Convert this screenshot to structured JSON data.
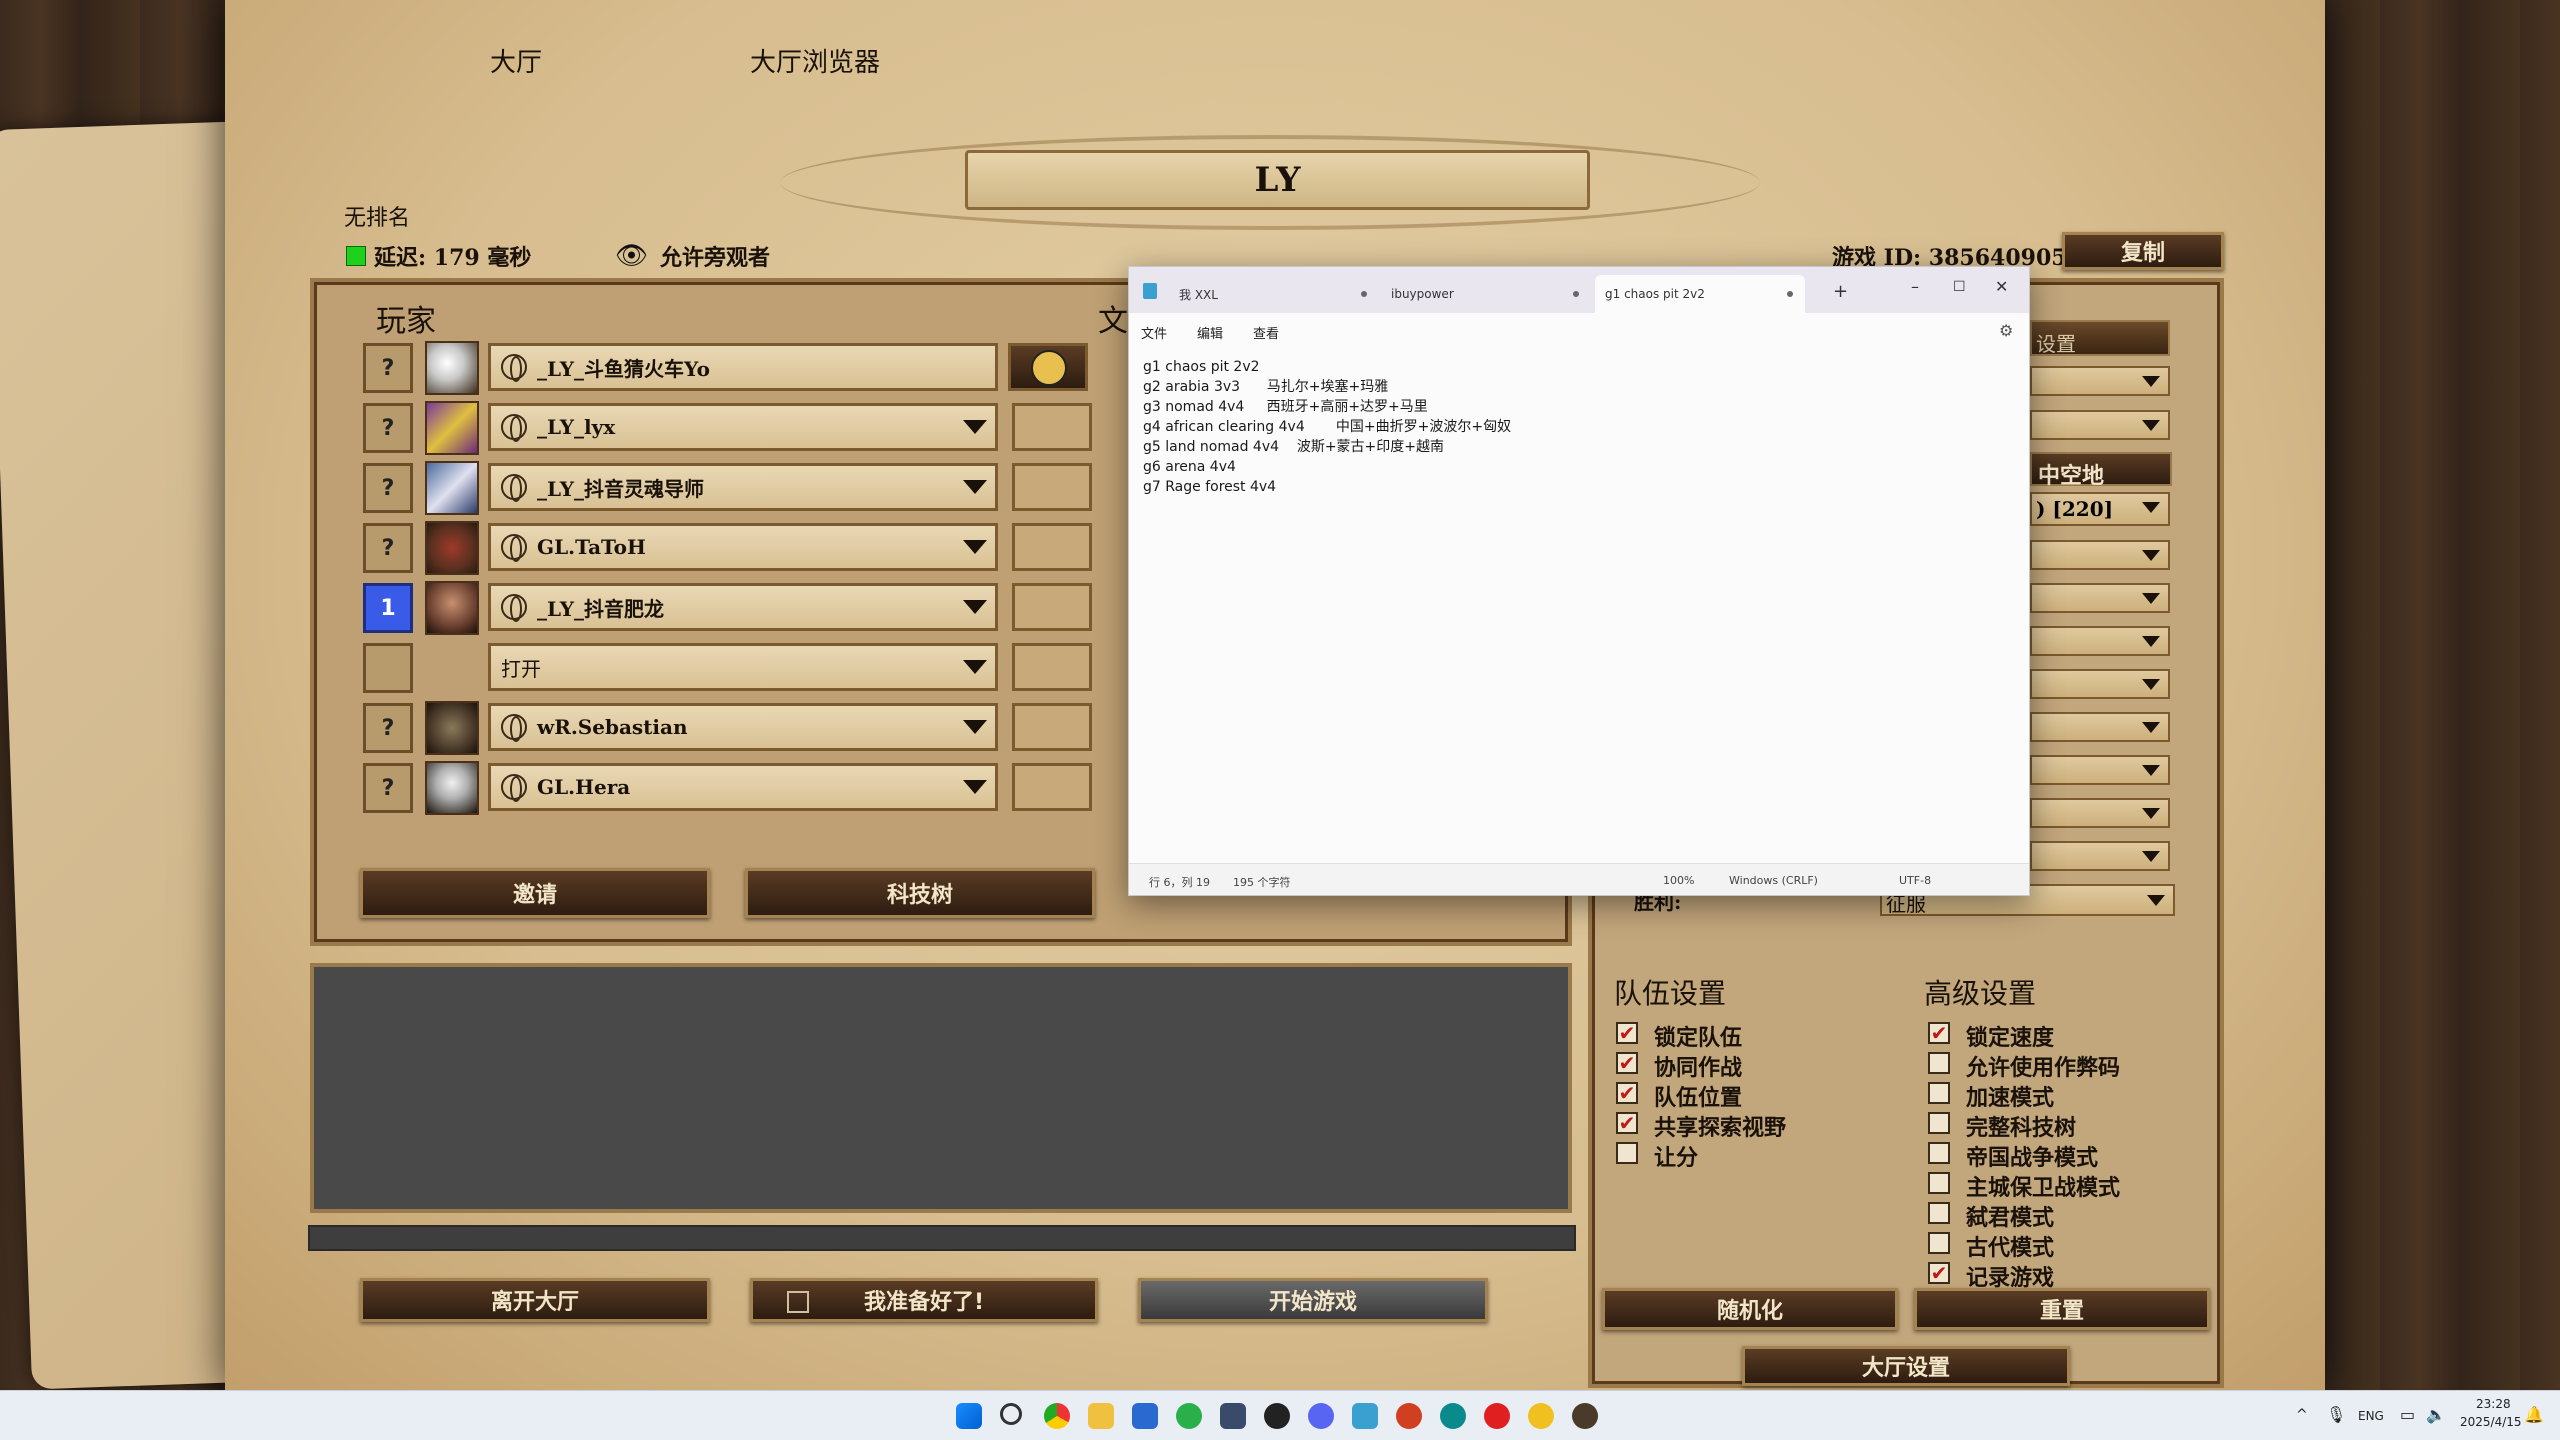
{
  "tabs": {
    "lobby": "大厅",
    "browser": "大厅浏览器"
  },
  "lobby_title": "LY",
  "rank": "无排名",
  "latency": "延迟: 179 毫秒",
  "spectators": "允许旁观者",
  "game_id": "游戏 ID: 385640905",
  "copy_button": "复制",
  "players_header": "玩家",
  "text_header_partial": "文",
  "players": [
    {
      "slot": "?",
      "name": "_LY_斗鱼猜火车Yo",
      "has_dropdown": false
    },
    {
      "slot": "?",
      "name": "_LY_lyx",
      "has_dropdown": true
    },
    {
      "slot": "?",
      "name": "_LY_抖音灵魂导师",
      "has_dropdown": true
    },
    {
      "slot": "?",
      "name": "GL.TaToH",
      "has_dropdown": true
    },
    {
      "slot": "1",
      "name": "_LY_抖音肥龙",
      "has_dropdown": true
    },
    {
      "slot": "",
      "name": "打开",
      "has_dropdown": true
    },
    {
      "slot": "?",
      "name": "wR.Sebastian",
      "has_dropdown": true
    },
    {
      "slot": "?",
      "name": "GL.Hera",
      "has_dropdown": true
    }
  ],
  "buttons": {
    "invite": "邀请",
    "tech_tree": "科技树",
    "leave": "离开大厅",
    "ready": "我准备好了!",
    "start": "开始游戏",
    "randomize": "随机化",
    "reset": "重置",
    "lobby_settings": "大厅设置"
  },
  "right_panel": {
    "settings_partial": "设置",
    "map_partial": "中空地",
    "size_partial": ") [220]",
    "victory_label_partial": "胜利:",
    "victory_value_partial": "征服"
  },
  "team_settings": {
    "title": "队伍设置",
    "items": [
      {
        "label": "锁定队伍",
        "checked": true
      },
      {
        "label": "协同作战",
        "checked": true
      },
      {
        "label": "队伍位置",
        "checked": true
      },
      {
        "label": "共享探索视野",
        "checked": true
      },
      {
        "label": "让分",
        "checked": false
      }
    ]
  },
  "advanced_settings": {
    "title": "高级设置",
    "items": [
      {
        "label": "锁定速度",
        "checked": true
      },
      {
        "label": "允许使用作弊码",
        "checked": false
      },
      {
        "label": "加速模式",
        "checked": false
      },
      {
        "label": "完整科技树",
        "checked": false
      },
      {
        "label": "帝国战争模式",
        "checked": false
      },
      {
        "label": "主城保卫战模式",
        "checked": false
      },
      {
        "label": "弑君模式",
        "checked": false
      },
      {
        "label": "古代模式",
        "checked": false
      },
      {
        "label": "记录游戏",
        "checked": true
      }
    ]
  },
  "notepad": {
    "tabs": [
      "我 XXL",
      "ibuypower",
      "g1 chaos pit 2v2"
    ],
    "menu": [
      "文件",
      "编辑",
      "查看"
    ],
    "lines": [
      "g1 chaos pit 2v2",
      "g2 arabia 3v3      马扎尔+埃塞+玛雅",
      "g3 nomad 4v4     西班牙+高丽+达罗+马里",
      "g4 african clearing 4v4       中国+曲折罗+波波尔+匈奴",
      "g5 land nomad 4v4    波斯+蒙古+印度+越南",
      "g6 arena 4v4",
      "g7 Rage forest 4v4"
    ],
    "status": {
      "position": "行 6，列 19",
      "chars": "195 个字符",
      "zoom": "100%",
      "line_ending": "Windows (CRLF)",
      "encoding": "UTF-8"
    }
  },
  "taskbar": {
    "lang": "ENG",
    "time": "23:28",
    "date": "2025/4/15"
  }
}
